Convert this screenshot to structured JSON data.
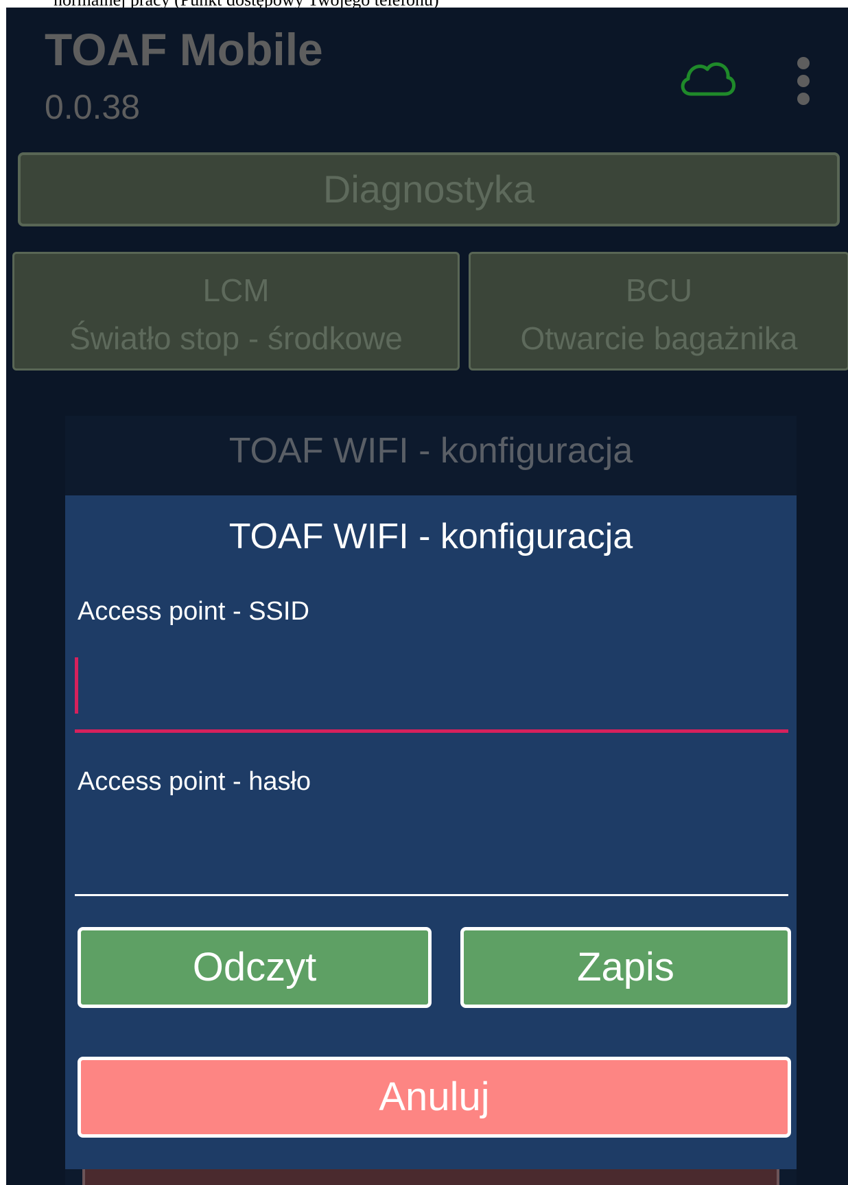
{
  "caption": "normalnej pracy (Punkt dostępowy Twojego telefonu)",
  "header": {
    "app_title": "TOAF Mobile",
    "version": "0.0.38",
    "cloud_icon": "cloud-icon",
    "cloud_color": "#1f8a2a",
    "menu_icon": "more-vert-icon"
  },
  "main": {
    "diagnostics_label": "Diagnostyka",
    "modules": [
      {
        "code": "LCM",
        "action": "Światło stop - środkowe"
      },
      {
        "code": "BCU",
        "action": "Otwarcie bagażnika"
      }
    ],
    "background_dialog_title": "TOAF WIFI - konfiguracja"
  },
  "dialog": {
    "title": "TOAF WIFI - konfiguracja",
    "ssid_label": "Access point - SSID",
    "ssid_value": "",
    "password_label": "Access point - hasło",
    "password_value": "",
    "read_button": "Odczyt",
    "save_button": "Zapis",
    "cancel_button": "Anuluj"
  },
  "colors": {
    "background": "#0b1627",
    "dialog": "#1e3c66",
    "accent": "#d6215c",
    "green_button": "#5ea064",
    "cancel_button": "#fd8583"
  }
}
